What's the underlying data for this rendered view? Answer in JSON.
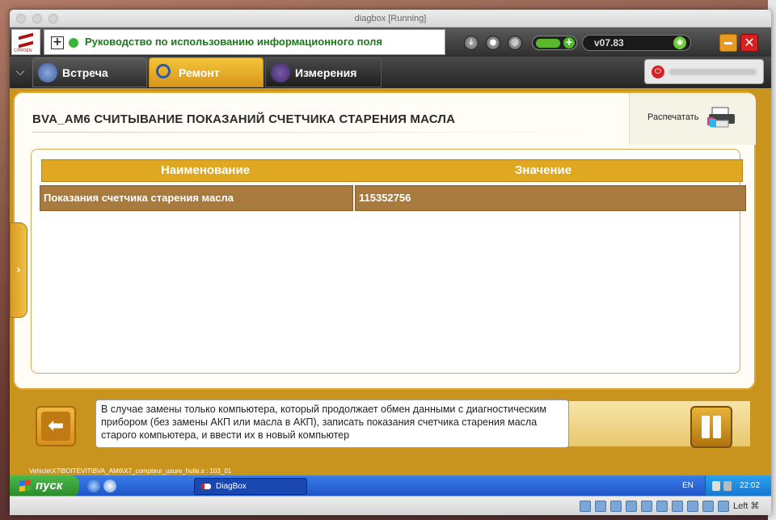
{
  "window": {
    "title": "diagbox [Running]"
  },
  "header": {
    "brand": "CITROËN",
    "guide_text": "Руководство по использованию информационного поля",
    "version": "v07.83",
    "min_label": "",
    "close_label": "✕"
  },
  "tabs": [
    {
      "label": "Встреча",
      "active": false
    },
    {
      "label": "Ремонт",
      "active": true
    },
    {
      "label": "Измерения",
      "active": false
    }
  ],
  "page": {
    "title": "BVA_AM6  СЧИТЫВАНИЕ ПОКАЗАНИЙ СЧЕТЧИКА СТАРЕНИЯ МАСЛА",
    "print_label": "Распечатать"
  },
  "table": {
    "headers": [
      "Наименование",
      "Значение"
    ],
    "rows": [
      {
        "name": "Показания счетчика старения масла",
        "value": "115352756"
      }
    ]
  },
  "footer": {
    "message": "В случае замены только компьютера, который продолжает обмен данными с диагностическим прибором (без замены АКП или масла в АКП), записать показания счетчика старения масла старого компьютера, и ввести их в новый компьютер",
    "path": "Vehicle\\X7\\BOITEVIT\\BVA_AM6\\X7_compteur_usure_huile.s : 103_01"
  },
  "taskbar": {
    "start_label": "пуск",
    "task_label": "DiagBox",
    "language": "EN",
    "clock": "22:02"
  },
  "vbox": {
    "host_key": "Left ⌘"
  },
  "colors": {
    "accent": "#e0a820",
    "panel": "#c8941e",
    "row": "#a97a3e",
    "guide_text": "#1a7a1a"
  }
}
